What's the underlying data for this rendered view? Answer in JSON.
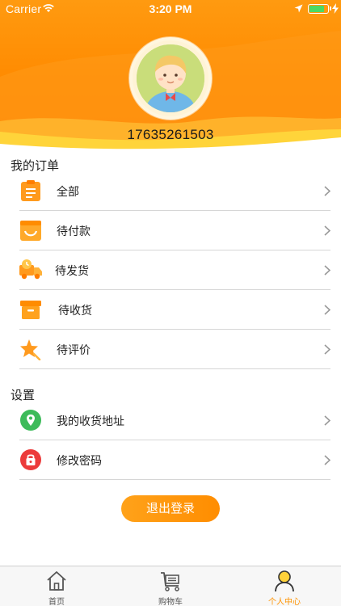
{
  "status_bar": {
    "carrier": "Carrier",
    "time": "3:20 PM"
  },
  "profile": {
    "phone": "17635261503"
  },
  "orders": {
    "title": "我的订单",
    "items": [
      {
        "label": "全部",
        "icon": "clipboard-icon"
      },
      {
        "label": "待付款",
        "icon": "wallet-icon"
      },
      {
        "label": "待发货",
        "icon": "delivery-truck-icon"
      },
      {
        "label": "待收货",
        "icon": "package-box-icon"
      },
      {
        "label": "待评价",
        "icon": "star-review-icon"
      }
    ]
  },
  "settings": {
    "title": "设置",
    "items": [
      {
        "label": "我的收货地址",
        "icon": "location-pin-icon"
      },
      {
        "label": "修改密码",
        "icon": "lock-icon"
      }
    ]
  },
  "logout_label": "退出登录",
  "tabbar": {
    "tabs": [
      {
        "label": "首页",
        "icon": "home-icon"
      },
      {
        "label": "购物车",
        "icon": "cart-icon"
      },
      {
        "label": "个人中心",
        "icon": "user-icon",
        "active": true
      }
    ]
  },
  "colors": {
    "accent": "#ff9300",
    "header": "#ff8a00",
    "battery": "#4cd964"
  }
}
